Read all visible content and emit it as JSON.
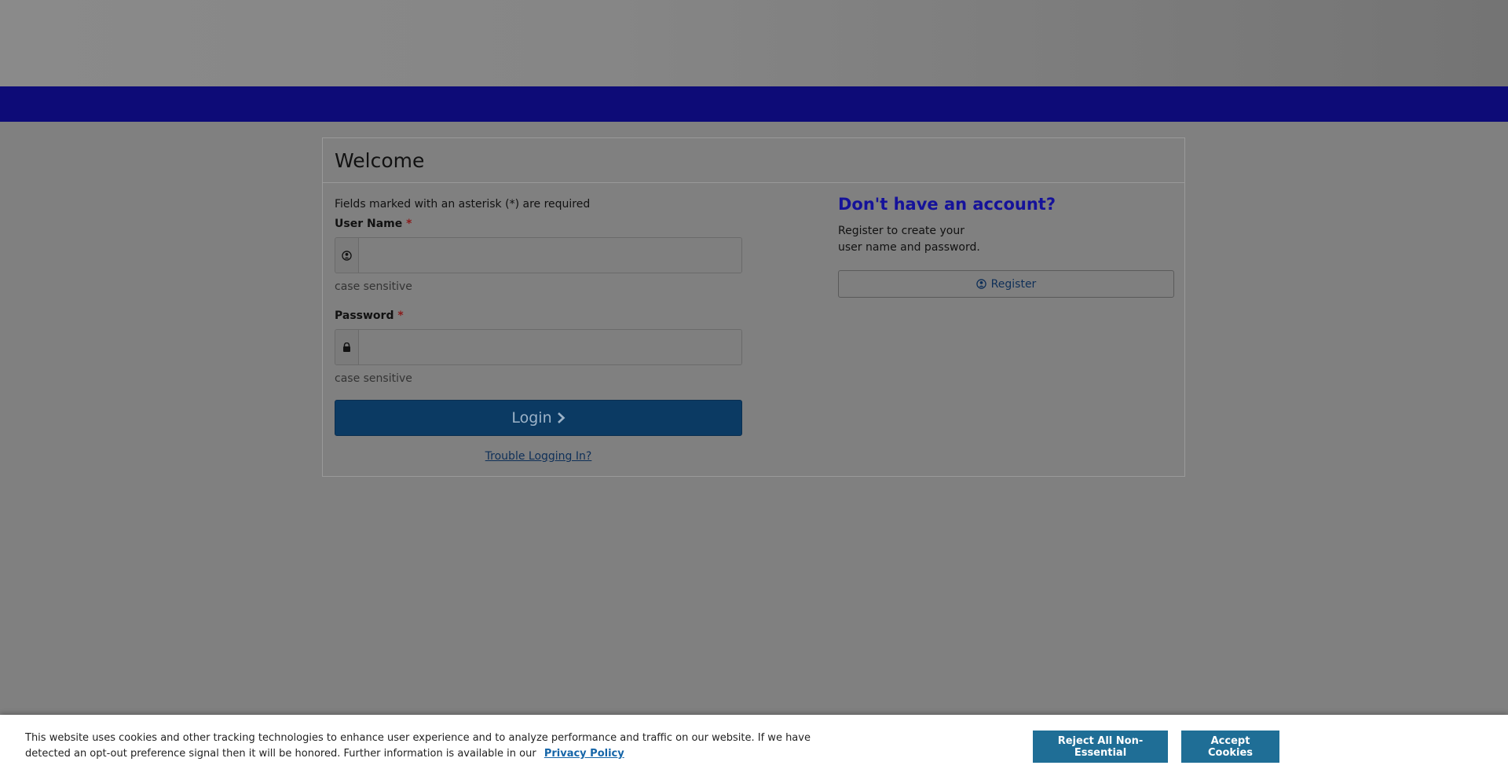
{
  "panel": {
    "title": "Welcome"
  },
  "login": {
    "required_note": "Fields marked with an asterisk (*) are required",
    "username_label": "User Name",
    "required_marker": "*",
    "username_value": "",
    "username_hint": "case sensitive",
    "password_label": "Password",
    "password_value": "",
    "password_hint": "case sensitive",
    "login_label": "Login",
    "trouble_link": "Trouble Logging In?"
  },
  "register": {
    "heading": "Don't have an account?",
    "text_line1": "Register to create your",
    "text_line2": "user name and password.",
    "button_label": "Register"
  },
  "cookie": {
    "text": "This website uses cookies and other tracking technologies to enhance user experience and to analyze performance and traffic on our website. If we have detected an opt-out preference signal then it will be honored. Further information is available in our",
    "privacy_link": "Privacy Policy",
    "reject_label": "Reject All Non-Essential",
    "accept_label": "Accept Cookies"
  },
  "icons": {
    "username": "user-icon",
    "password": "lock-icon",
    "login": "chevron-right-icon",
    "register": "user-icon"
  },
  "colors": {
    "nav_bar": "#0d0b77",
    "login_button": "#0b3a63",
    "heading": "#15129a",
    "cookie_button": "#1f6e96"
  }
}
